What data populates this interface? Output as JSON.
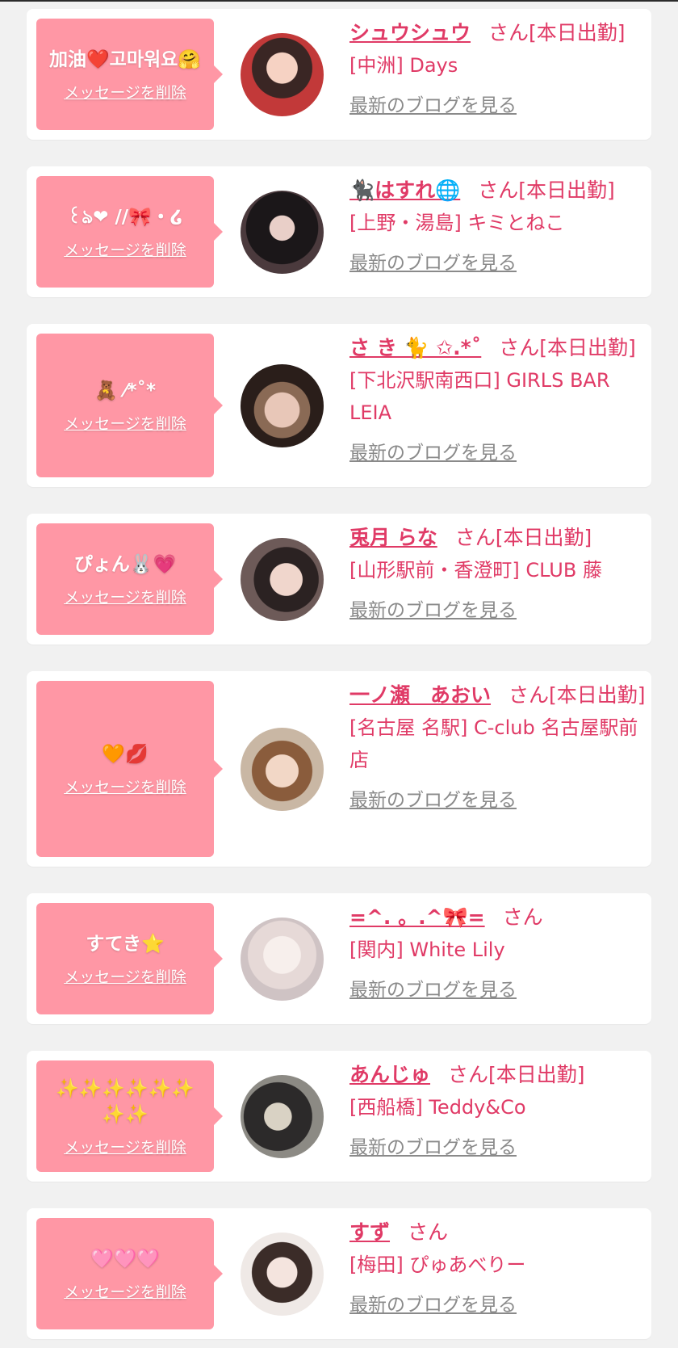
{
  "delete_label": "メッセージを削除",
  "blog_label": "最新のブログを見る",
  "colors": {
    "bubble": "#ff97a5",
    "accent": "#e03a66",
    "link_gray": "#8a8a8a",
    "background": "#f1f1f1"
  },
  "cards": [
    {
      "message": "加油❤️고마워요🤗",
      "name": "シュウシュウ",
      "status": "さん[本日出勤]",
      "shop": "[中洲] Days"
    },
    {
      "message": "꒰ঌ❤︎ //🎀・໒",
      "name": "🐈‍⬛はすれ🌐",
      "status": "さん[本日出勤]",
      "shop": "[上野・湯島] キミとねこ"
    },
    {
      "message": "🧸 ⁄*˚*",
      "name": "さ き 🐈 ✩.*˚",
      "status": "さん[本日出勤]",
      "shop": "[下北沢駅南西口] GIRLS BAR LEIA"
    },
    {
      "message": "ぴょん🐰💗",
      "name": "兎月 らな",
      "status": "さん[本日出勤]",
      "shop": "[山形駅前・香澄町] CLUB 藤"
    },
    {
      "message": "🧡💋",
      "name": "一ノ瀬　あおい",
      "status": "さん[本日出勤]",
      "shop": "[名古屋 名駅] C-club 名古屋駅前店"
    },
    {
      "message": "すてき⭐️",
      "name": "=^. 。.^🎀=",
      "status": "さん",
      "shop": "[関内] White Lily"
    },
    {
      "message": "✨✨✨✨✨✨✨✨",
      "name": "あんじゅ",
      "status": "さん[本日出勤]",
      "shop": "[西船橋] Teddy&Co"
    },
    {
      "message": "🩷🩷🩷",
      "name": "すず",
      "status": "さん",
      "shop": "[梅田] ぴゅあべりー"
    }
  ]
}
